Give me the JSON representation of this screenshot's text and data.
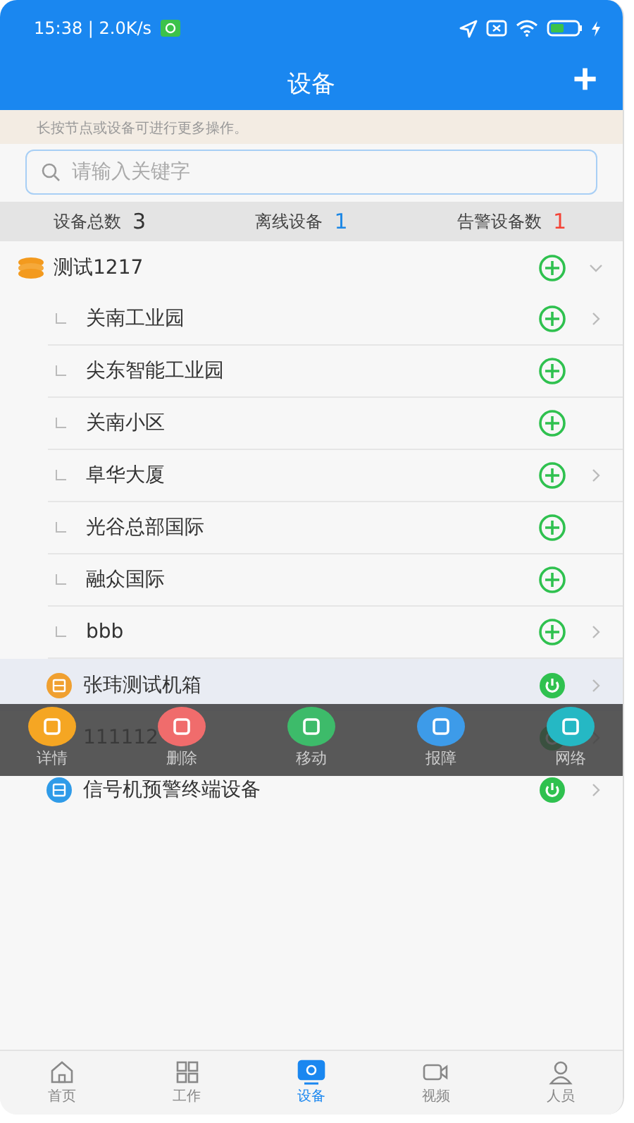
{
  "status_bar": {
    "time": "15:38 | 2.0K/s"
  },
  "header": {
    "title": "设备",
    "add_button": "+"
  },
  "hint": "长按节点或设备可进行更多操作。",
  "search": {
    "placeholder": "请输入关键字"
  },
  "stats": [
    {
      "label": "设备总数",
      "value": "3",
      "color": "#333333"
    },
    {
      "label": "离线设备",
      "value": "1",
      "color": "#1e88e5"
    },
    {
      "label": "告警设备数",
      "value": "1",
      "color": "#f44336"
    }
  ],
  "tree": {
    "name": "测试1217",
    "expanded": true,
    "children": [
      {
        "kind": "area",
        "name": "关南工业园",
        "expandable": true
      },
      {
        "kind": "area",
        "name": "尖东智能工业园",
        "expandable": false
      },
      {
        "kind": "area",
        "name": "关南小区",
        "expandable": false
      },
      {
        "kind": "area",
        "name": "阜华大厦",
        "expandable": true
      },
      {
        "kind": "area",
        "name": "光谷总部国际",
        "expandable": false
      },
      {
        "kind": "area",
        "name": "融众国际",
        "expandable": false
      },
      {
        "kind": "area",
        "name": "bbb",
        "expandable": true
      },
      {
        "kind": "device",
        "name": "张玮测试机箱",
        "selected": true,
        "color": "#f0a030"
      },
      {
        "kind": "device",
        "name": "111112",
        "selected": false
      },
      {
        "kind": "device",
        "name": "信号机预警终端设备",
        "selected": false,
        "color": "#2f9be8"
      }
    ]
  },
  "action_menu": [
    {
      "label": "详情",
      "color": "#f5a623"
    },
    {
      "label": "删除",
      "color": "#f06c6c"
    },
    {
      "label": "移动",
      "color": "#3dbb6a"
    },
    {
      "label": "报障",
      "color": "#3d9be9"
    },
    {
      "label": "网络",
      "color": "#25b8c4"
    }
  ],
  "tabs": [
    {
      "label": "首页",
      "selected": false
    },
    {
      "label": "工作",
      "selected": false
    },
    {
      "label": "设备",
      "selected": true
    },
    {
      "label": "视频",
      "selected": false
    },
    {
      "label": "人员",
      "selected": false
    }
  ]
}
